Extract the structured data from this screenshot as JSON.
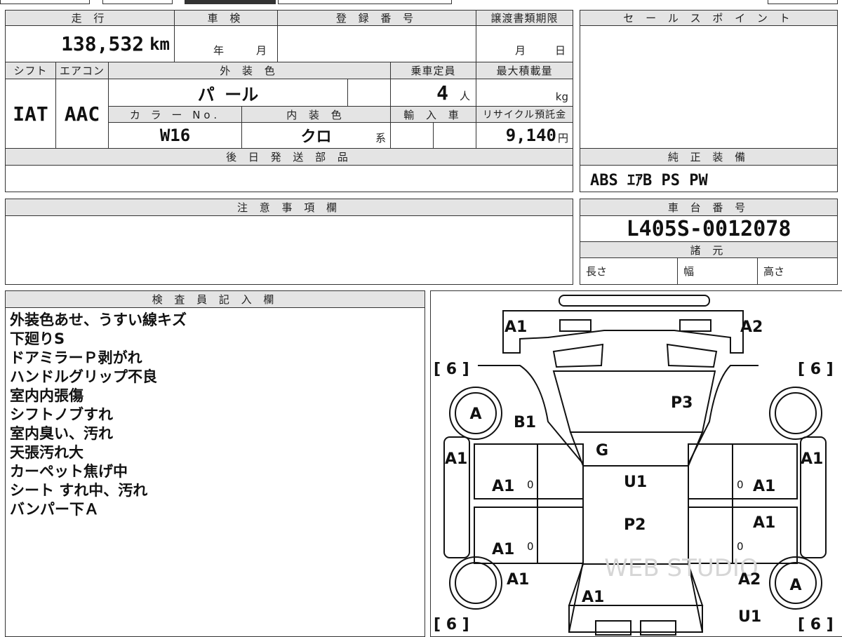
{
  "vehicle": {
    "mileage_header": "走 行",
    "mileage_value": "138,532",
    "mileage_unit": "km",
    "inspection_header": "車 検",
    "inspection_year_unit": "年",
    "inspection_month_unit": "月",
    "reg_number_header": "登 録 番 号",
    "transfer_deadline_header": "譲渡書類期限",
    "transfer_month_unit": "月",
    "transfer_day_unit": "日",
    "shift_header": "シフト",
    "shift_value": "IAT",
    "aircon_header": "エアコン",
    "aircon_value": "AAC",
    "exterior_color_header": "外 装 色",
    "exterior_color_value": "パ ール",
    "capacity_header": "乗車定員",
    "capacity_value": "4",
    "capacity_unit": "人",
    "max_load_header": "最大積載量",
    "max_load_unit": "kg",
    "color_no_header": "カ ラ ー No.",
    "color_no_value": "W16",
    "interior_color_header": "内 装 色",
    "interior_color_value": "クロ",
    "interior_color_suffix": "系",
    "import_header": "輸 入 車",
    "recycle_header": "リサイクル預託金",
    "recycle_value": "9,140",
    "recycle_unit": "円",
    "later_parts_header": "後 日 発 送 部 品"
  },
  "sales_point": {
    "header": "セ ー ル ス ポ イ ン ト"
  },
  "genuine_equipment": {
    "header": "純 正 装 備",
    "value": "ABS ｴｱB PS PW"
  },
  "notes": {
    "header": "注 意 事 項 欄"
  },
  "chassis": {
    "header": "車 台 番 号",
    "value": "L405S-0012078"
  },
  "specs": {
    "header": "諸 元",
    "length_label": "長さ",
    "width_label": "幅",
    "height_label": "高さ"
  },
  "inspector": {
    "header": "検 査 員 記 入 欄",
    "remarks": [
      "外装色あせ、うすい線キズ",
      "下廻りS",
      "ドアミラーＰ剥がれ",
      "ハンドルグリップ不良",
      "室内内張傷",
      "シフトノブすれ",
      "室内臭い、汚れ",
      "天張汚れ大",
      "カーペット焦げ中",
      "シート すれ中、汚れ",
      "バンパー下Ａ"
    ]
  },
  "diagram": {
    "tire_tl": "[ 6 ]",
    "tire_tr": "[ 6 ]",
    "tire_bl": "[ 6 ]",
    "tire_br": "[ 6 ]",
    "front_left": "A1",
    "front_right": "A2",
    "wheel_front_left": "A",
    "fender_front_left": "B1",
    "hood": "P3",
    "windshield": "G",
    "roof_front": "U1",
    "roof_rear": "P2",
    "left_side_pillar": "A1",
    "right_side_pillar": "A1",
    "left_front_door": "A1",
    "right_front_door": "A1",
    "right_rear_door": "A1",
    "left_rear_door": "A1",
    "left_rear_fender": "A1",
    "rear_center": "A1",
    "right_rear_fender": "A2",
    "wheel_rear_right": "A",
    "rear_right_bottom": "U1",
    "door_marker": "0",
    "watermark": "WEB STUDIO"
  }
}
